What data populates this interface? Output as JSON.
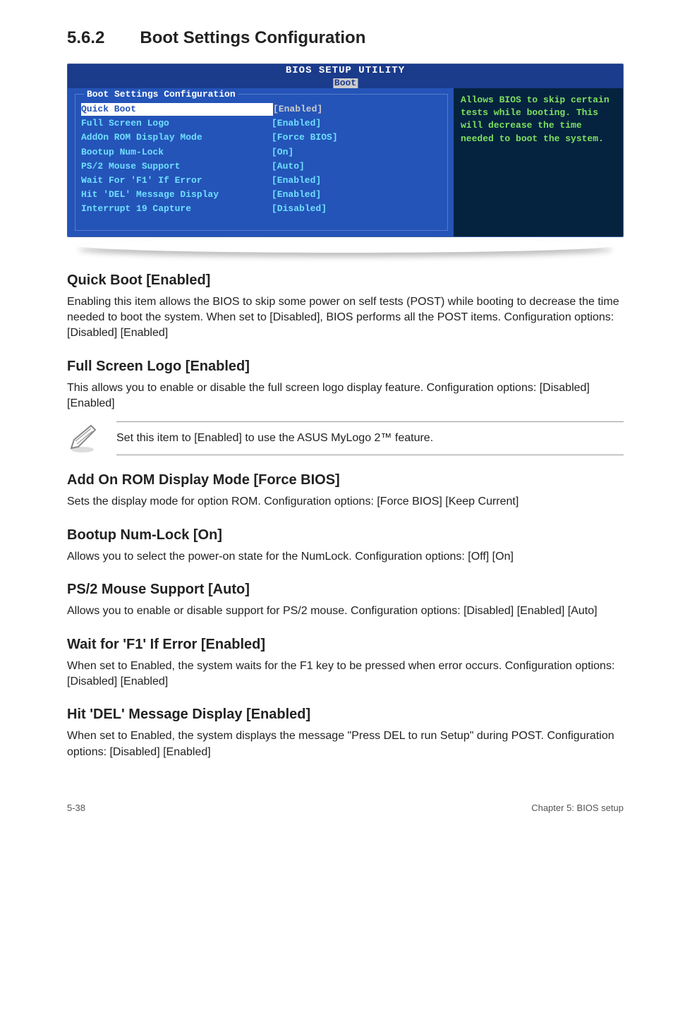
{
  "heading": {
    "number": "5.6.2",
    "title": "Boot Settings Configuration"
  },
  "bios": {
    "titlebar": "BIOS SETUP UTILITY",
    "tab": "Boot",
    "section_title": "Boot Settings Configuration",
    "rows": [
      {
        "label": "Quick Boot",
        "value": "[Enabled]",
        "hi": true
      },
      {
        "label": "Full Screen Logo",
        "value": "[Enabled]",
        "hi": false
      },
      {
        "label": "AddOn ROM Display Mode",
        "value": "[Force BIOS]",
        "hi": false
      },
      {
        "label": "Bootup Num-Lock",
        "value": "[On]",
        "hi": false
      },
      {
        "label": "PS/2 Mouse Support",
        "value": "[Auto]",
        "hi": false
      },
      {
        "label": "Wait For 'F1' If Error",
        "value": "[Enabled]",
        "hi": false
      },
      {
        "label": "Hit 'DEL' Message Display",
        "value": "[Enabled]",
        "hi": false
      },
      {
        "label": "Interrupt 19 Capture",
        "value": "[Disabled]",
        "hi": false
      }
    ],
    "help_text": "Allows BIOS to skip certain tests while booting. This will decrease the time needed to boot the system."
  },
  "sections": [
    {
      "title": "Quick Boot [Enabled]",
      "body": "Enabling this item allows the BIOS to skip some power on self tests (POST) while booting to decrease the time needed to boot the system. When set to [Disabled], BIOS performs all the POST items. Configuration options: [Disabled] [Enabled]"
    },
    {
      "title": "Full Screen Logo [Enabled]",
      "body": "This allows you to enable or disable the full screen logo display feature. Configuration options: [Disabled] [Enabled]"
    }
  ],
  "note": "Set this item to [Enabled] to use the ASUS MyLogo 2™ feature.",
  "sections2": [
    {
      "title": "Add On ROM Display Mode [Force BIOS]",
      "body": "Sets the display mode for option ROM. Configuration options: [Force BIOS] [Keep Current]"
    },
    {
      "title": "Bootup Num-Lock [On]",
      "body": "Allows you to select the power-on state for the NumLock. Configuration options: [Off] [On]"
    },
    {
      "title": "PS/2 Mouse Support [Auto]",
      "body": "Allows you to enable or disable support for PS/2 mouse. Configuration options: [Disabled] [Enabled] [Auto]"
    },
    {
      "title": "Wait for 'F1' If Error [Enabled]",
      "body": "When set to Enabled, the system waits for the F1 key to be pressed when error occurs. Configuration options: [Disabled] [Enabled]"
    },
    {
      "title": "Hit 'DEL' Message Display [Enabled]",
      "body": "When set to Enabled, the system displays the message \"Press DEL to run Setup\" during POST. Configuration options: [Disabled] [Enabled]"
    }
  ],
  "footer": {
    "left": "5-38",
    "right": "Chapter 5: BIOS setup"
  }
}
